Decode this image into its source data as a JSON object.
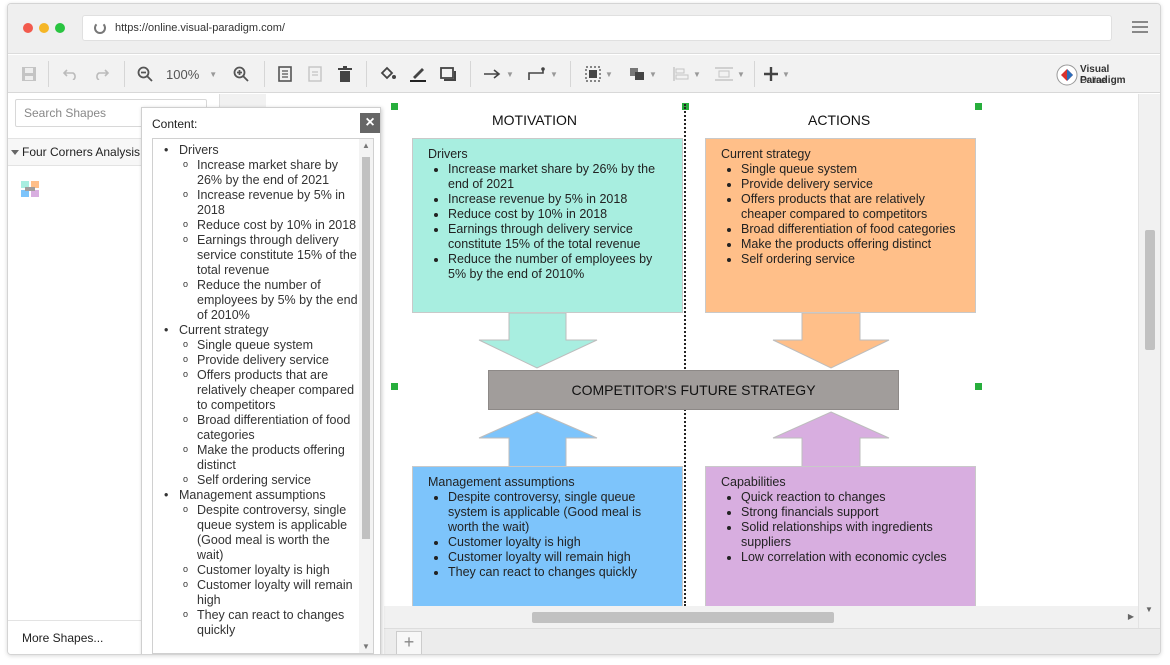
{
  "browser": {
    "url": "https://online.visual-paradigm.com/"
  },
  "toolbar": {
    "zoom": "100%"
  },
  "brand": {
    "line1": "Visual Paradigm",
    "line2": "Online"
  },
  "sidebar": {
    "search_placeholder": "Search Shapes",
    "category": "Four Corners Analysis",
    "more_shapes": "More Shapes..."
  },
  "panel": {
    "title": "Content:",
    "tree": [
      {
        "label": "Drivers",
        "items": [
          "Increase market share by 26% by the end of 2021",
          "Increase revenue by 5% in 2018",
          "Reduce cost by 10% in 2018",
          "Earnings through delivery service constitute 15% of the total revenue",
          "Reduce the number of employees by 5% by the end of 2010%"
        ]
      },
      {
        "label": "Current strategy",
        "items": [
          "Single queue system",
          "Provide delivery service",
          "Offers products that are relatively cheaper compared to competitors",
          "Broad differentiation of food categories",
          "Make the products offering distinct",
          "Self ordering service"
        ]
      },
      {
        "label": "Management assumptions",
        "items": [
          "Despite controversy, single queue system is applicable (Good meal is worth the wait)",
          "Customer loyalty is high",
          "Customer loyalty will remain high",
          "They can react to changes quickly"
        ]
      }
    ]
  },
  "diagram": {
    "headings": {
      "left": "MOTIVATION",
      "right": "ACTIONS"
    },
    "center": "COMPETITOR'S FUTURE STRATEGY",
    "drivers": {
      "title": "Drivers",
      "items": [
        "Increase market share by 26% by the end of 2021",
        "Increase revenue by 5% in 2018",
        "Reduce cost by 10% in 2018",
        "Earnings through delivery service constitute 15% of the total revenue",
        "Reduce the number of employees by 5% by the end of 2010%"
      ]
    },
    "strategy": {
      "title": "Current strategy",
      "items": [
        "Single queue system",
        "Provide delivery service",
        "Offers products that are relatively cheaper compared to competitors",
        "Broad differentiation of food categories",
        "Make the products offering distinct",
        "Self ordering service"
      ]
    },
    "assumptions": {
      "title": "Management assumptions",
      "items": [
        "Despite controversy, single queue system is applicable (Good meal is worth the wait)",
        "Customer loyalty is high",
        "Customer loyalty will remain high",
        "They can react to changes quickly"
      ]
    },
    "capabilities": {
      "title": "Capabilities",
      "items": [
        "Quick reaction to changes",
        "Strong financials support",
        "Solid relationships with ingredients suppliers",
        "Low correlation with economic cycles"
      ]
    }
  },
  "colors": {
    "drivers": "#a8eee0",
    "strategy": "#ffbf89",
    "assumptions": "#7dc4fb",
    "capabilities": "#d8aee0",
    "center": "#a19d9b",
    "selection_handle": "#27ae3c"
  }
}
